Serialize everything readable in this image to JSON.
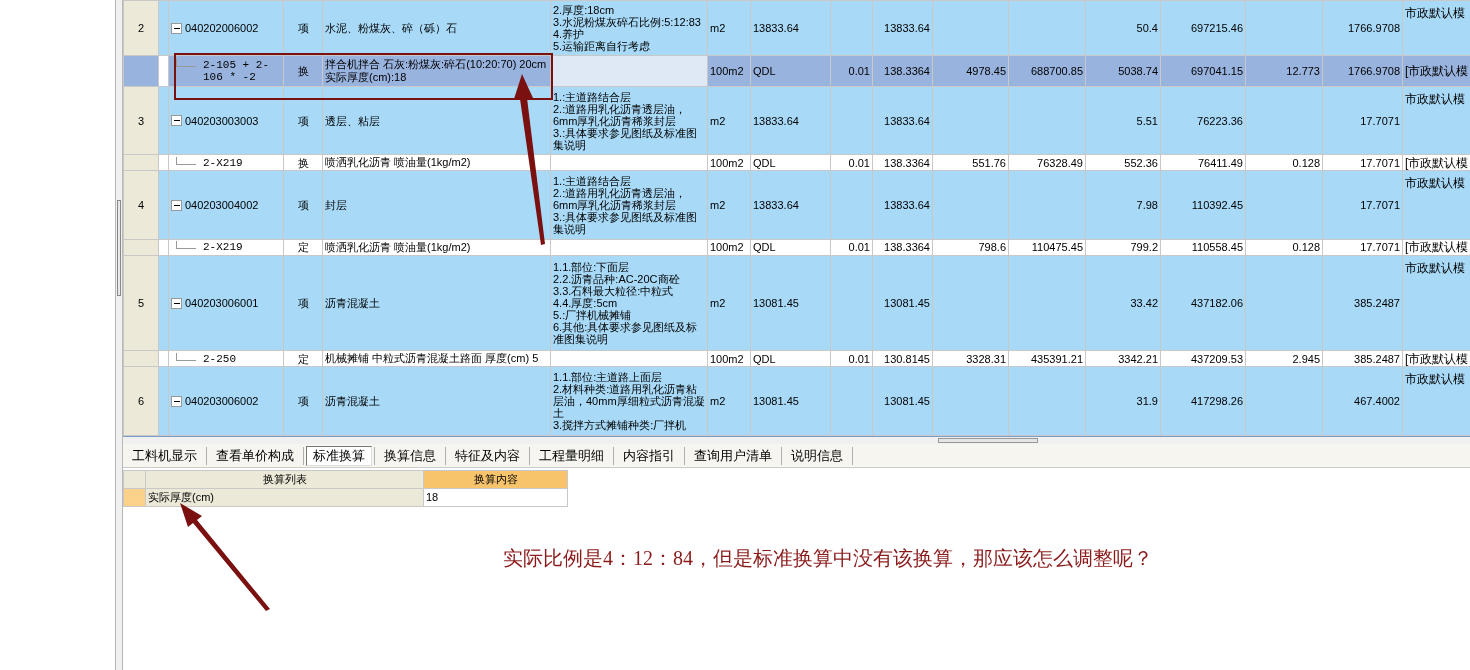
{
  "rows": [
    {
      "kind": "item",
      "selected": false,
      "expanded": true,
      "number": "2",
      "code": "040202006002",
      "type": "项",
      "name": "水泥、粉煤灰、碎（砾）石",
      "features": [
        "2.厚度:18cm",
        "3.水泥粉煤灰碎石比例:5:12:83",
        "4.养护",
        "5.运输距离自行考虑"
      ],
      "unit": "m2",
      "expression": "13833.64",
      "quantity": "13833.64",
      "amounts": {
        "column_13": "50.4",
        "column_14": "697215.46",
        "column_16": "1766.9708"
      },
      "remark": "市政默认模"
    },
    {
      "kind": "sub",
      "selected": true,
      "code": "2-105 + 2-106 * -2",
      "type": "换",
      "name": "拌合机拌合 石灰:粉煤灰:碎石(10:20:70) 20cm 实际厚度(cm):18",
      "unit": "100m2",
      "expression": "QDL",
      "coefficient": "0.01",
      "quantity": "138.3364",
      "amounts": {
        "column_11": "4978.45",
        "column_12": "688700.85",
        "column_13": "5038.74",
        "column_14": "697041.15",
        "column_15": "12.773",
        "column_16": "1766.9708"
      },
      "remark": "[市政默认模"
    },
    {
      "kind": "item",
      "selected": false,
      "expanded": true,
      "number": "3",
      "code": "040203003003",
      "type": "项",
      "name": "透层、粘层",
      "features": [
        "1.:主道路结合层",
        "2.:道路用乳化沥青透层油，6mm厚乳化沥青稀浆封层",
        "3.:具体要求参见图纸及标准图集说明"
      ],
      "unit": "m2",
      "expression": "13833.64",
      "quantity": "13833.64",
      "amounts": {
        "column_13": "5.51",
        "column_14": "76223.36",
        "column_16": "17.7071"
      },
      "remark": "市政默认模"
    },
    {
      "kind": "sub",
      "selected": false,
      "code": "2-X219",
      "type": "换",
      "name": "喷洒乳化沥青 喷油量(1kg/m2)",
      "unit": "100m2",
      "expression": "QDL",
      "coefficient": "0.01",
      "quantity": "138.3364",
      "amounts": {
        "column_11": "551.76",
        "column_12": "76328.49",
        "column_13": "552.36",
        "column_14": "76411.49",
        "column_15": "0.128",
        "column_16": "17.7071"
      },
      "remark": "[市政默认模"
    },
    {
      "kind": "item",
      "selected": false,
      "expanded": true,
      "number": "4",
      "code": "040203004002",
      "type": "项",
      "name": "封层",
      "features": [
        "1.:主道路结合层",
        "2.:道路用乳化沥青透层油，6mm厚乳化沥青稀浆封层",
        "3.:具体要求参见图纸及标准图集说明"
      ],
      "unit": "m2",
      "expression": "13833.64",
      "quantity": "13833.64",
      "amounts": {
        "column_13": "7.98",
        "column_14": "110392.45",
        "column_16": "17.7071"
      },
      "remark": "市政默认模"
    },
    {
      "kind": "sub",
      "selected": false,
      "code": "2-X219",
      "type": "定",
      "name": "喷洒乳化沥青 喷油量(1kg/m2)",
      "unit": "100m2",
      "expression": "QDL",
      "coefficient": "0.01",
      "quantity": "138.3364",
      "amounts": {
        "column_11": "798.6",
        "column_12": "110475.45",
        "column_13": "799.2",
        "column_14": "110558.45",
        "column_15": "0.128",
        "column_16": "17.7071"
      },
      "remark": "[市政默认模"
    },
    {
      "kind": "item",
      "selected": false,
      "expanded": true,
      "number": "5",
      "code": "040203006001",
      "type": "项",
      "name": "沥青混凝土",
      "features": [
        "1.1.部位:下面层",
        "2.2.沥青品种:AC-20C商砼",
        "3.3.石料最大粒径:中粒式",
        "4.4.厚度:5cm",
        "5.:厂拌机械摊铺",
        "6.其他:具体要求参见图纸及标准图集说明"
      ],
      "unit": "m2",
      "expression": "13081.45",
      "quantity": "13081.45",
      "amounts": {
        "column_13": "33.42",
        "column_14": "437182.06",
        "column_16": "385.2487"
      },
      "remark": "市政默认模"
    },
    {
      "kind": "sub",
      "selected": false,
      "code": "2-250",
      "type": "定",
      "name": "机械摊铺 中粒式沥青混凝土路面 厚度(cm) 5",
      "unit": "100m2",
      "expression": "QDL",
      "coefficient": "0.01",
      "quantity": "130.8145",
      "amounts": {
        "column_11": "3328.31",
        "column_12": "435391.21",
        "column_13": "3342.21",
        "column_14": "437209.53",
        "column_15": "2.945",
        "column_16": "385.2487"
      },
      "remark": "[市政默认模"
    },
    {
      "kind": "item",
      "selected": false,
      "expanded": true,
      "number": "6",
      "code": "040203006002",
      "type": "项",
      "name": "沥青混凝土",
      "features": [
        "1.1.部位:主道路上面层",
        "2.材料种类:道路用乳化沥青粘层油，40mm厚细粒式沥青混凝土",
        "3.搅拌方式摊铺种类:厂拌机"
      ],
      "unit": "m2",
      "expression": "13081.45",
      "quantity": "13081.45",
      "amounts": {
        "column_13": "31.9",
        "column_14": "417298.26",
        "column_16": "467.4002"
      },
      "remark": "市政默认模"
    }
  ],
  "tabs": [
    {
      "label": "工料机显示",
      "selected": false
    },
    {
      "label": "查看单价构成",
      "selected": false
    },
    {
      "label": "标准换算",
      "selected": true
    },
    {
      "label": "换算信息",
      "selected": false
    },
    {
      "label": "特征及内容",
      "selected": false
    },
    {
      "label": "工程量明细",
      "selected": false
    },
    {
      "label": "内容指引",
      "selected": false
    },
    {
      "label": "查询用户清单",
      "selected": false
    },
    {
      "label": "说明信息",
      "selected": false
    }
  ],
  "conversion_grid": {
    "columns": [
      "换算列表",
      "换算内容"
    ],
    "rows": [
      {
        "name": "实际厚度(cm)",
        "value": "18"
      }
    ]
  },
  "annotation": "实际比例是4：12：84，但是标准换算中没有该换算，那应该怎么调整呢？"
}
